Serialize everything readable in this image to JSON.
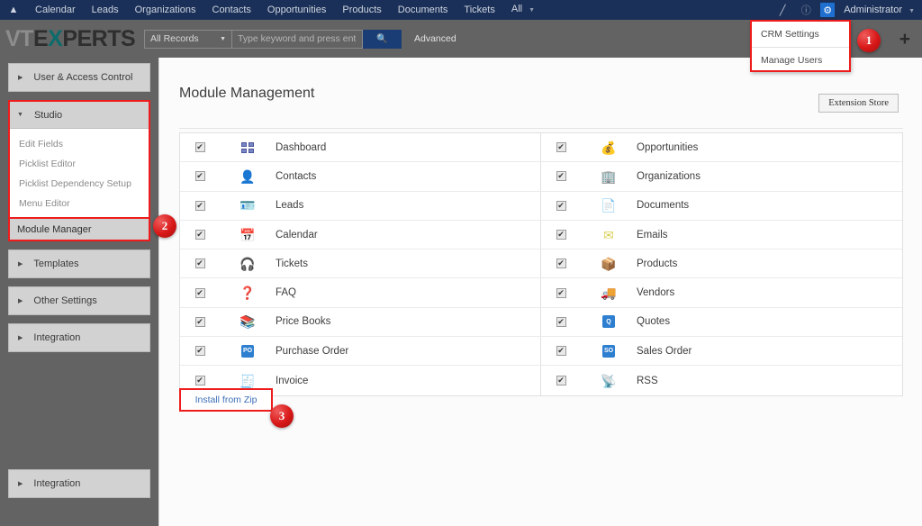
{
  "topnav": {
    "home_icon": "home-icon",
    "items": [
      "Calendar",
      "Leads",
      "Organizations",
      "Contacts",
      "Opportunities",
      "Products",
      "Documents",
      "Tickets"
    ],
    "all_label": "All",
    "pencil_icon": "pencil-icon",
    "info_icon": "info-icon",
    "gear_icon": "gear-icon",
    "user_label": "Administrator"
  },
  "logobar": {
    "logo": {
      "vt": "VT",
      "e": "E",
      "x": "X",
      "perts": "PERTS"
    },
    "record_filter": "All Records",
    "search_placeholder": "Type keyword and press enter",
    "search_value": "",
    "search_icon": "search-icon",
    "advanced_label": "Advanced",
    "plus_icon": "plus-icon"
  },
  "settings_menu": {
    "items": [
      "CRM Settings",
      "Manage Users"
    ]
  },
  "sidebar": {
    "user_access": "User & Access Control",
    "studio": "Studio",
    "studio_sub": [
      "Edit Fields",
      "Picklist Editor",
      "Picklist Dependency Setup",
      "Menu Editor"
    ],
    "module_manager": "Module Manager",
    "templates": "Templates",
    "other_settings": "Other Settings",
    "integration_1": "Integration",
    "integration_2": "Integration"
  },
  "main": {
    "page_title": "Module Management",
    "extension_store": "Extension Store",
    "install_from_zip": "Install from Zip"
  },
  "modules": {
    "left": [
      {
        "name": "Dashboard",
        "icon": "dashboard-icon",
        "glyph": "",
        "color": "#7b86c6",
        "checked": true
      },
      {
        "name": "Contacts",
        "icon": "contact-person-icon",
        "glyph": "👤",
        "color": "#e8a33d",
        "checked": true
      },
      {
        "name": "Leads",
        "icon": "lead-card-icon",
        "glyph": "🪪",
        "color": "#8fa5c4",
        "checked": true
      },
      {
        "name": "Calendar",
        "icon": "calendar-icon",
        "glyph": "📅",
        "color": "#4a6fb5",
        "checked": true
      },
      {
        "name": "Tickets",
        "icon": "headset-icon",
        "glyph": "🎧",
        "color": "#2b2b2b",
        "checked": true
      },
      {
        "name": "FAQ",
        "icon": "question-mark-icon",
        "glyph": "❓",
        "color": "#1565c0",
        "checked": true
      },
      {
        "name": "Price Books",
        "icon": "books-icon",
        "glyph": "📚",
        "color": "#b98a5a",
        "checked": true
      },
      {
        "name": "Purchase Order",
        "icon": "purchase-order-icon",
        "glyph": "PO",
        "color": "#2f7fd0",
        "checked": true
      },
      {
        "name": "Invoice",
        "icon": "invoice-icon",
        "glyph": "🧾",
        "color": "#2f7fd0",
        "checked": true
      }
    ],
    "right": [
      {
        "name": "Opportunities",
        "icon": "money-bag-icon",
        "glyph": "💰",
        "color": "#c98a2e",
        "checked": true
      },
      {
        "name": "Organizations",
        "icon": "buildings-icon",
        "glyph": "🏢",
        "color": "#5aa04a",
        "checked": true
      },
      {
        "name": "Documents",
        "icon": "document-icon",
        "glyph": "📄",
        "color": "#7d9cc0",
        "checked": true
      },
      {
        "name": "Emails",
        "icon": "envelope-icon",
        "glyph": "✉",
        "color": "#d9cf52",
        "checked": true
      },
      {
        "name": "Products",
        "icon": "package-box-icon",
        "glyph": "📦",
        "color": "#a98048",
        "checked": true
      },
      {
        "name": "Vendors",
        "icon": "delivery-truck-icon",
        "glyph": "🚚",
        "color": "#e89a3c",
        "checked": true
      },
      {
        "name": "Quotes",
        "icon": "quote-icon",
        "glyph": "Q",
        "color": "#2f7fd0",
        "checked": true
      },
      {
        "name": "Sales Order",
        "icon": "sales-order-icon",
        "glyph": "SO",
        "color": "#2f7fd0",
        "checked": true
      },
      {
        "name": "RSS",
        "icon": "rss-icon",
        "glyph": "📡",
        "color": "#ef8120",
        "checked": true
      }
    ],
    "checkmark": "✔"
  },
  "badges": [
    {
      "label": "1"
    },
    {
      "label": "2"
    },
    {
      "label": "3"
    }
  ],
  "colors": {
    "navy": "#1b3058",
    "annotation_red": "#ee1c1c",
    "link_blue": "#3b6fb6",
    "sidebar_grey": "#636363"
  }
}
